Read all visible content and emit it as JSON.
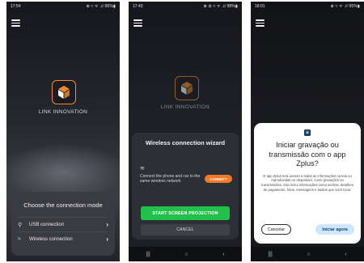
{
  "screen1": {
    "status": {
      "time": "17:54",
      "right": "⊗ ≈ ᯤ .ıl 96%▮"
    },
    "brand": "LINK INNOVATION",
    "sheet": {
      "title": "Choose the connection mode",
      "items": [
        {
          "label": "USB connection",
          "icon": "usb-icon"
        },
        {
          "label": "Wireless connection",
          "icon": "wifi-icon"
        }
      ]
    }
  },
  "screen2": {
    "status": {
      "time": "17:43",
      "right": "⊗ ⊘ ≈ ᯤ .ıl 98%▮"
    },
    "brand": "LINK INNOVATION",
    "dialog": {
      "title": "Wireless connection wizard",
      "instruction": "Connect the phone and car to the same wireless network",
      "connect_label": "CONNECT",
      "start_label": "START SCREEN PROJECTION",
      "cancel_label": "CANCEL"
    },
    "nav": {
      "recent": "|||",
      "home": "○",
      "back": "‹"
    }
  },
  "screen3": {
    "status": {
      "time": "18:01",
      "right": "⊗ ≈ ᯤ .ıl 95%▮"
    },
    "dialog": {
      "title": "Iniciar gravação ou transmissão com o app Zplus?",
      "body": "O app Zplus terá acesso a todas as informações na tela ou reproduzidas no dispositivo, como gravações ou transmissões. Isso inclui informações como senhas, detalhes de pagamento, fotos, mensagens e áudios que você tocar.",
      "cancel_label": "Cancelar",
      "start_label": "Iniciar agora"
    },
    "nav": {
      "recent": "|||",
      "home": "○",
      "back": "‹"
    }
  },
  "colors": {
    "accent_orange": "#f07a27",
    "green": "#22c24a",
    "dark_bg": "#1b1c21",
    "sheet_bg": "#3a3b40",
    "light_blue": "#cfe6ff"
  }
}
